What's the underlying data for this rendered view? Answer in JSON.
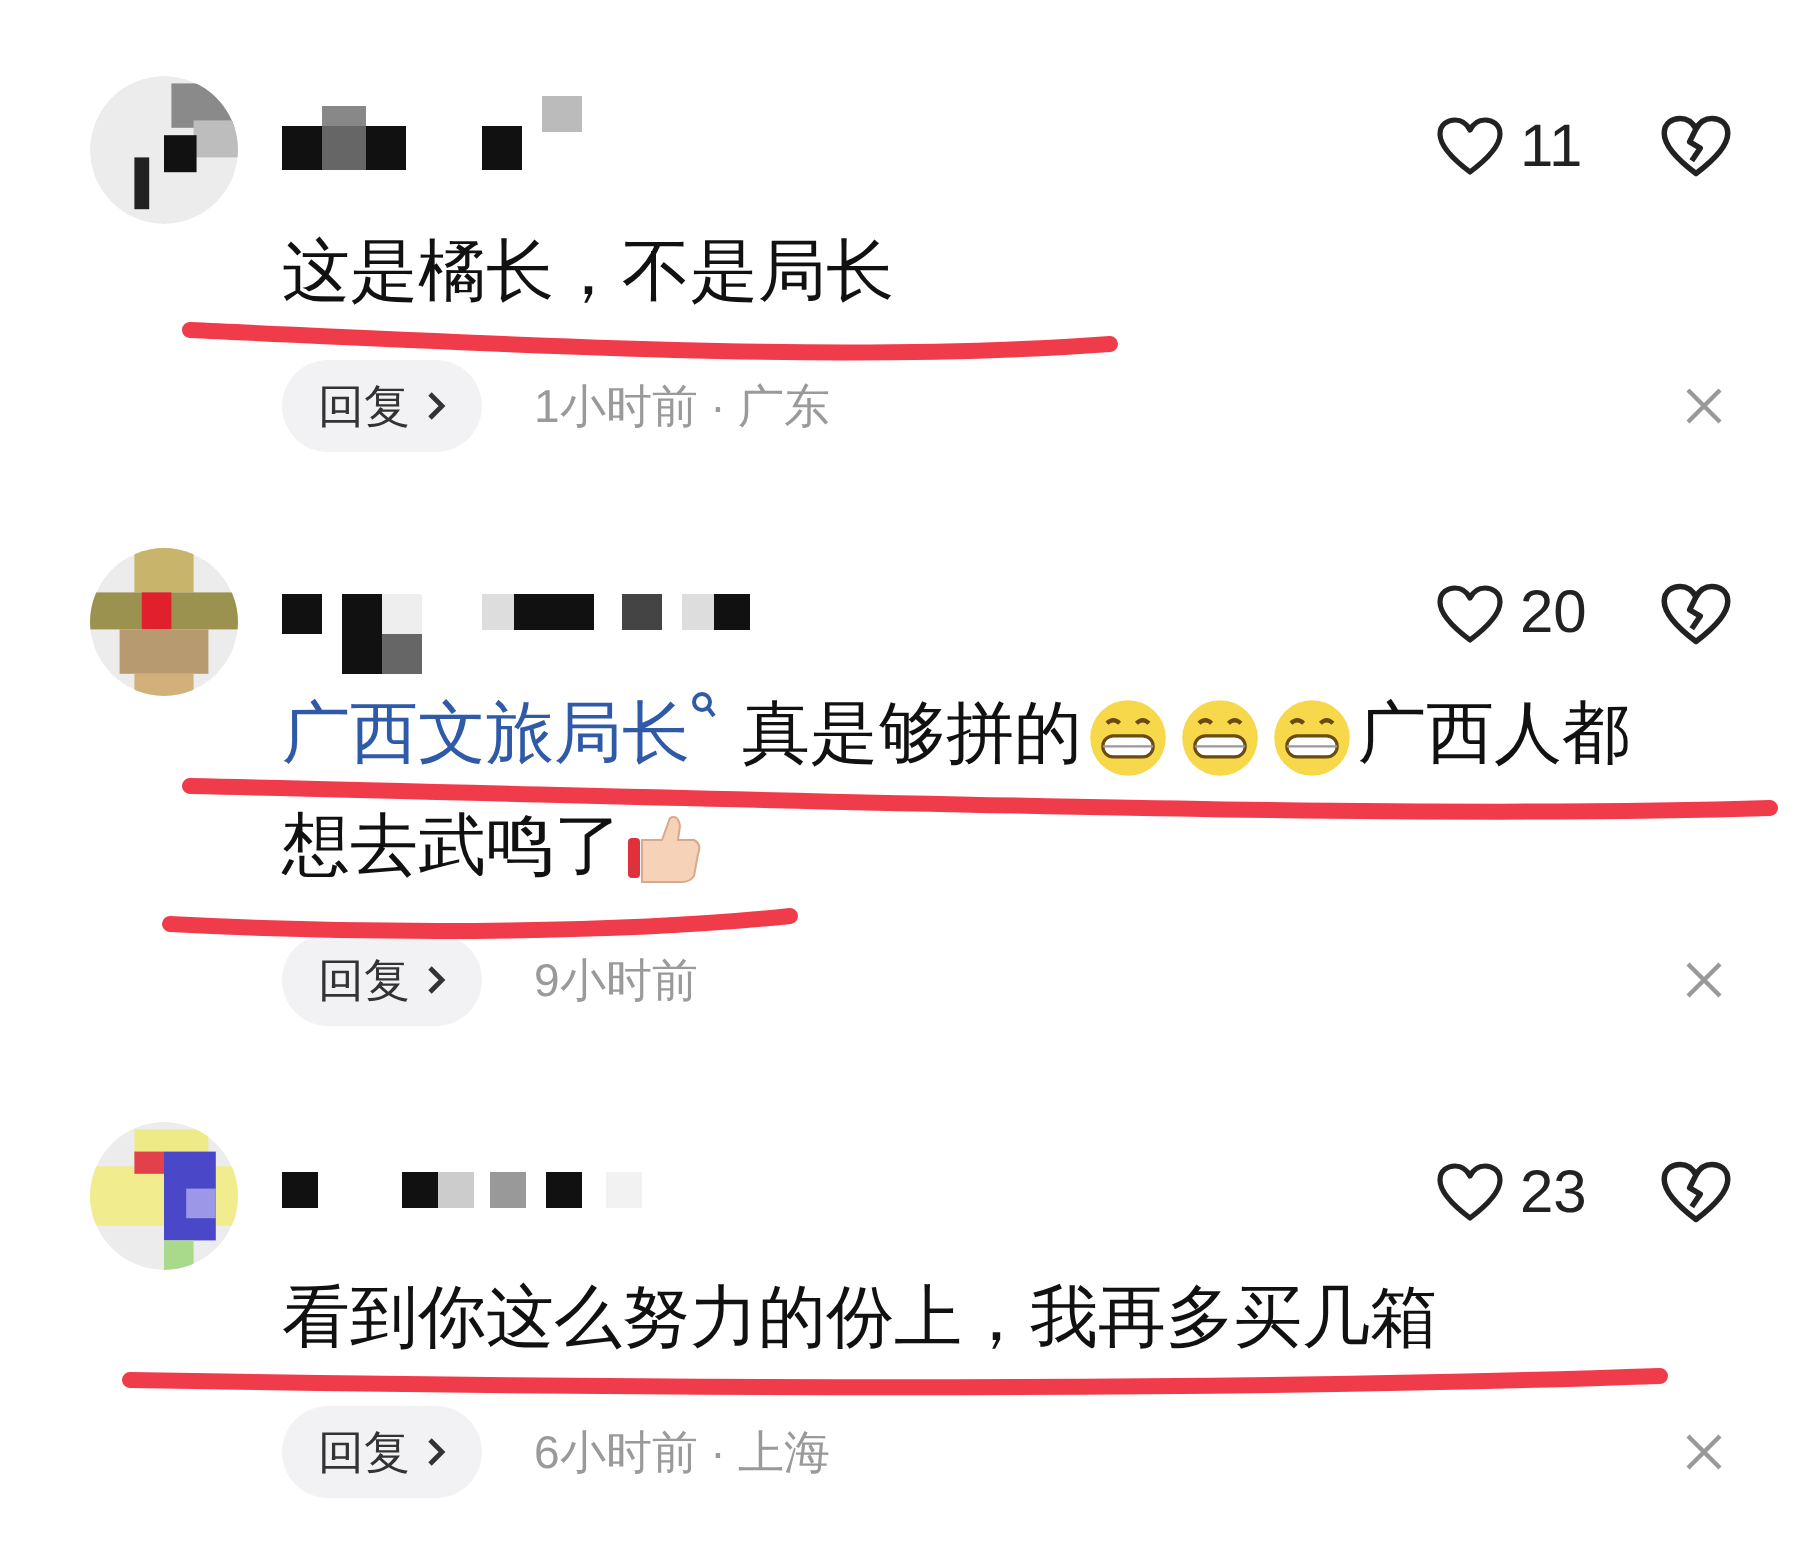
{
  "comments": [
    {
      "likes": "11",
      "segments": [
        {
          "kind": "text",
          "text": "这是橘长，不是局长"
        }
      ],
      "reply": "回复",
      "time": "1小时前 · 广东"
    },
    {
      "likes": "20",
      "segments": [
        {
          "kind": "link",
          "text": "广西文旅局长"
        },
        {
          "kind": "text",
          "text": "真是够拼的"
        },
        {
          "kind": "grin-emoji"
        },
        {
          "kind": "grin-emoji"
        },
        {
          "kind": "grin-emoji"
        },
        {
          "kind": "text",
          "text": "广西人都"
        },
        {
          "kind": "text",
          "text": "想去武鸣了"
        },
        {
          "kind": "thumb-emoji"
        }
      ],
      "reply": "回复",
      "time": "9小时前"
    },
    {
      "likes": "23",
      "segments": [
        {
          "kind": "text",
          "text": "看到你这么努力的份上，我再多买几箱"
        }
      ],
      "reply": "回复",
      "time": "6小时前 · 上海"
    }
  ]
}
